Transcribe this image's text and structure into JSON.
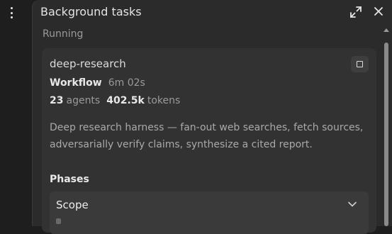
{
  "panel": {
    "title": "Background tasks",
    "section_label": "Running"
  },
  "icons": {
    "menu": "kebab-menu-icon",
    "expand": "expand-icon",
    "close": "close-icon",
    "stop": "stop-icon",
    "chevron": "chevron-down-icon"
  },
  "task": {
    "name": "deep-research",
    "type_label": "Workflow",
    "duration": "6m 02s",
    "agents_count": "23",
    "agents_label": "agents",
    "tokens_count": "402.5k",
    "tokens_label": "tokens",
    "description": "Deep research harness — fan-out web searches, fetch sources, adversarially verify claims, synthesize a cited report."
  },
  "phases": {
    "heading": "Phases",
    "items": [
      {
        "name": "Scope"
      }
    ]
  },
  "colors": {
    "panel_bg": "#2b2b2b",
    "card_bg": "#323232",
    "phase_bg": "#3a3a3a"
  }
}
